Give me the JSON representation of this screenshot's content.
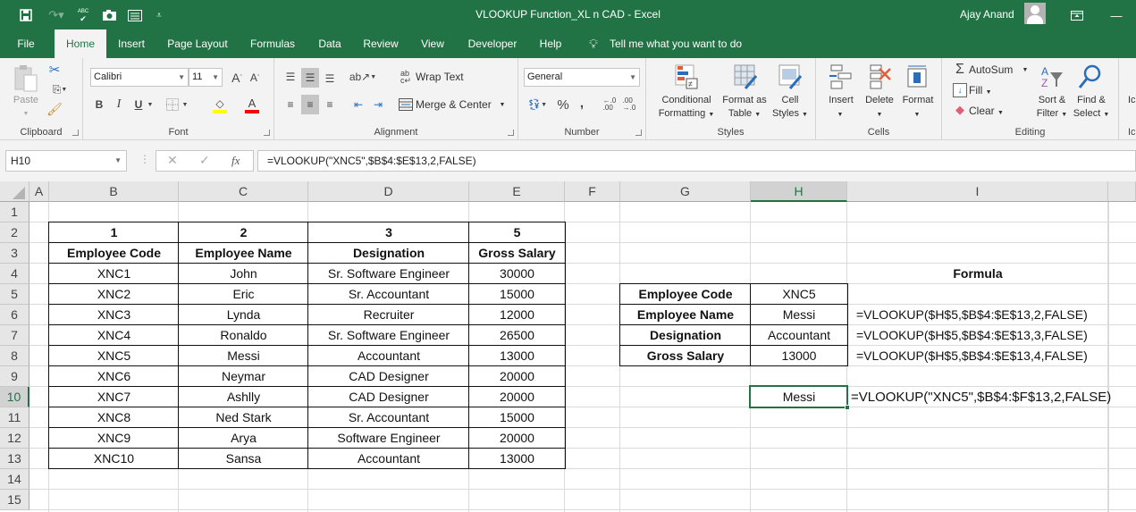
{
  "window": {
    "title": "VLOOKUP Function_XL n CAD  -  Excel",
    "user": "Ajay Anand"
  },
  "qat": {
    "icons": [
      "save-icon",
      "redo-icon",
      "spelling-icon",
      "camera-icon",
      "form-icon",
      "customize-icon"
    ]
  },
  "tabs": [
    {
      "label": "File"
    },
    {
      "label": "Home",
      "active": true
    },
    {
      "label": "Insert"
    },
    {
      "label": "Page Layout"
    },
    {
      "label": "Formulas"
    },
    {
      "label": "Data"
    },
    {
      "label": "Review"
    },
    {
      "label": "View"
    },
    {
      "label": "Developer"
    },
    {
      "label": "Help"
    }
  ],
  "tell_me": "Tell me what you want to do",
  "ribbon": {
    "clipboard": {
      "label": "Clipboard",
      "paste": "Paste"
    },
    "font": {
      "label": "Font",
      "name": "Calibri",
      "size": "11",
      "bold": "B",
      "italic": "I",
      "underline": "U"
    },
    "alignment": {
      "label": "Alignment",
      "wrap": "Wrap Text",
      "merge": "Merge & Center"
    },
    "number": {
      "label": "Number",
      "format": "General",
      "percent": "%",
      "comma": ","
    },
    "styles": {
      "label": "Styles",
      "conditional": [
        "Conditional",
        "Formatting"
      ],
      "format_table": [
        "Format as",
        "Table"
      ],
      "cell_styles": [
        "Cell",
        "Styles"
      ]
    },
    "cells": {
      "label": "Cells",
      "insert": "Insert",
      "delete": "Delete",
      "format": "Format"
    },
    "editing": {
      "label": "Editing",
      "autosum": "AutoSum",
      "fill": "Fill",
      "clear": "Clear",
      "sort": [
        "Sort &",
        "Filter"
      ],
      "find": [
        "Find &",
        "Select"
      ]
    },
    "ideas": {
      "label_top": "Ic",
      "label_bottom": "Ic"
    }
  },
  "formula_bar": {
    "name_box": "H10",
    "fx": "fx",
    "formula": "=VLOOKUP(\"XNC5\",$B$4:$E$13,2,FALSE)"
  },
  "sheet": {
    "columns": [
      "A",
      "B",
      "C",
      "D",
      "E",
      "F",
      "G",
      "H",
      "I"
    ],
    "selected_column": "H",
    "rows": [
      "1",
      "2",
      "3",
      "4",
      "5",
      "6",
      "7",
      "8",
      "9",
      "10",
      "11",
      "12",
      "13",
      "14",
      "15"
    ],
    "selected_row": "10",
    "index_row": [
      "1",
      "2",
      "3",
      "5"
    ],
    "headers": [
      "Employee Code",
      "Employee Name",
      "Designation",
      "Gross Salary"
    ],
    "data": [
      [
        "XNC1",
        "John",
        "Sr. Software Engineer",
        "30000"
      ],
      [
        "XNC2",
        "Eric",
        "Sr. Accountant",
        "15000"
      ],
      [
        "XNC3",
        "Lynda",
        "Recruiter",
        "12000"
      ],
      [
        "XNC4",
        "Ronaldo",
        "Sr. Software Engineer",
        "26500"
      ],
      [
        "XNC5",
        "Messi",
        "Accountant",
        "13000"
      ],
      [
        "XNC6",
        "Neymar",
        "CAD Designer",
        "20000"
      ],
      [
        "XNC7",
        "Ashlly",
        "CAD Designer",
        "20000"
      ],
      [
        "XNC8",
        "Ned Stark",
        "Sr. Accountant",
        "15000"
      ],
      [
        "XNC9",
        "Arya",
        "Software Engineer",
        "20000"
      ],
      [
        "XNC10",
        "Sansa",
        "Accountant",
        "13000"
      ]
    ],
    "formula_heading": "Formula",
    "lookup": [
      {
        "label": "Employee Code",
        "value": "XNC5",
        "formula": ""
      },
      {
        "label": "Employee Name",
        "value": "Messi",
        "formula": "=VLOOKUP($H$5,$B$4:$E$13,2,FALSE)"
      },
      {
        "label": "Designation",
        "value": "Accountant",
        "formula": "=VLOOKUP($H$5,$B$4:$E$13,3,FALSE)"
      },
      {
        "label": "Gross Salary",
        "value": "13000",
        "formula": "=VLOOKUP($H$5,$B$4:$E$13,4,FALSE)"
      }
    ],
    "active_cell": {
      "ref": "H10",
      "value": "Messi",
      "formula_text": "=VLOOKUP(\"XNC5\",$B$4:$F$13,2,FALSE)"
    }
  }
}
